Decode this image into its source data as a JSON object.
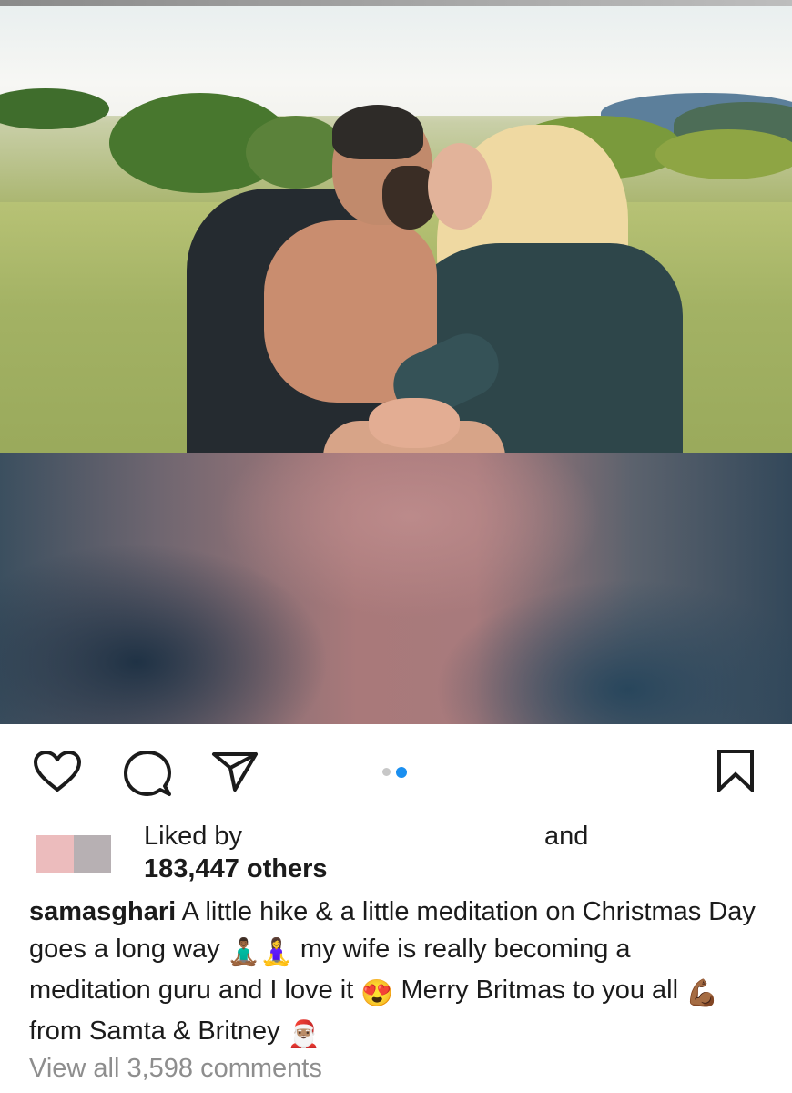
{
  "post": {
    "carousel": {
      "total": 2,
      "active": 2
    },
    "liked": {
      "prefix": "Liked by",
      "count": "183,447 others",
      "and": "and"
    },
    "caption": {
      "username": "samasghari",
      "text_1": " A little hike & a little meditation on Christmas Day goes a long way ",
      "emoji_1": "🧘🏾‍♂️",
      "emoji_2": "🧘‍♀️",
      "text_2": " my wife is really becoming a meditation guru and I love it ",
      "emoji_3": "😍",
      "text_3": " Merry Britmas to you all ",
      "emoji_4": "💪🏾",
      "text_4": " from Samta & Britney ",
      "emoji_5": "🎅🏽"
    },
    "comments_link": "View all 3,598 comments"
  },
  "icons": {
    "like": "heart-outline",
    "comment": "speech-bubble-outline",
    "share": "paper-plane-outline",
    "save": "bookmark-outline"
  },
  "colors": {
    "accent": "#1a8ff0",
    "inactive_dot": "#c7c7c7",
    "muted_text": "#8e8e8e"
  }
}
